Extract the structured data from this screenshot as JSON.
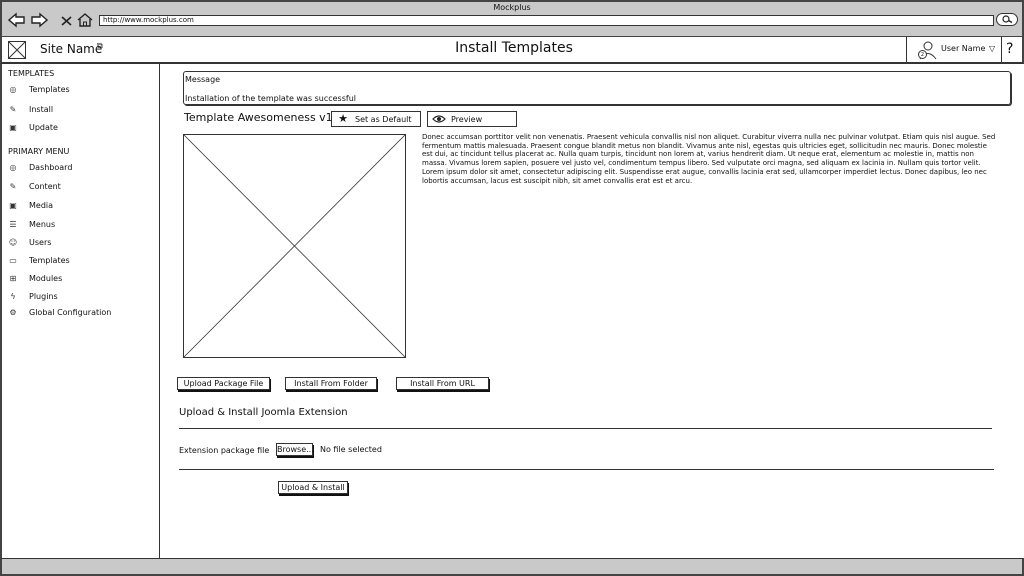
{
  "browser": {
    "title": "Mockplus",
    "url": "http://www.mockplus.com",
    "icons": [
      "back-arrow-icon",
      "forward-arrow-icon",
      "close-icon",
      "home-icon",
      "search-icon"
    ]
  },
  "header": {
    "site_name": "Site Name",
    "page_title": "Install Templates",
    "user_name": "User Name",
    "user_badge": "2",
    "help": "?"
  },
  "sidebar": {
    "templates_heading": "TEMPLATES",
    "templates_items": [
      {
        "label": "Templates",
        "icon": "globe-icon"
      },
      {
        "label": "Install",
        "icon": "pencil-icon"
      },
      {
        "label": "Update",
        "icon": "image-icon"
      }
    ],
    "primary_heading": "PRIMARY MENU",
    "primary_items": [
      {
        "label": "Dashboard",
        "icon": "globe-icon"
      },
      {
        "label": "Content",
        "icon": "pencil-icon"
      },
      {
        "label": "Media",
        "icon": "image-icon"
      },
      {
        "label": "Menus",
        "icon": "list-icon"
      },
      {
        "label": "Users",
        "icon": "user-icon"
      },
      {
        "label": "Templates",
        "icon": "monitor-icon"
      },
      {
        "label": "Modules",
        "icon": "module-icon"
      },
      {
        "label": "Plugins",
        "icon": "plug-icon"
      },
      {
        "label": "Global Configuration",
        "icon": "gear-icon"
      }
    ]
  },
  "message": {
    "title": "Message",
    "body": "Installation of the template was successful"
  },
  "template": {
    "name": "Template Awesomeness v1",
    "set_default_label": "Set as Default",
    "preview_label": "Preview",
    "description": "Donec accumsan porttitor velit non venenatis. Praesent vehicula convallis nisl non aliquet. Curabitur viverra nulla nec pulvinar volutpat. Etiam quis nisl augue. Sed fermentum mattis malesuada. Praesent congue blandit metus non blandit. Vivamus ante nisl, egestas quis ultricies eget, sollicitudin nec mauris. Donec molestie est dui, ac tincidunt tellus placerat ac. Nulla quam turpis, tincidunt non lorem at, varius hendrerit diam. Ut neque erat, elementum ac molestie in, mattis non massa. Vivamus lorem sapien, posuere vel justo vel, condimentum tempus libero. Sed vulputate orci magna, sed aliquam ex lacinia in. Nullam quis tortor velit. Lorem ipsum dolor sit amet, consectetur adipiscing elit. Suspendisse erat augue, convallis lacinia erat sed, ullamcorper imperdiet lectus. Donec dapibus, leo nec lobortis accumsan, lacus est suscipit nibh, sit amet convallis erat est et arcu."
  },
  "install_tabs": [
    {
      "label": "Upload Package File"
    },
    {
      "label": "Install From Folder"
    },
    {
      "label": "Install From URL"
    }
  ],
  "upload": {
    "section_title": "Upload & Install Joomla Extension",
    "field_label": "Extension package file",
    "browse_label": "Browse...",
    "file_status": "No file selected",
    "submit_label": "Upload & Install"
  }
}
